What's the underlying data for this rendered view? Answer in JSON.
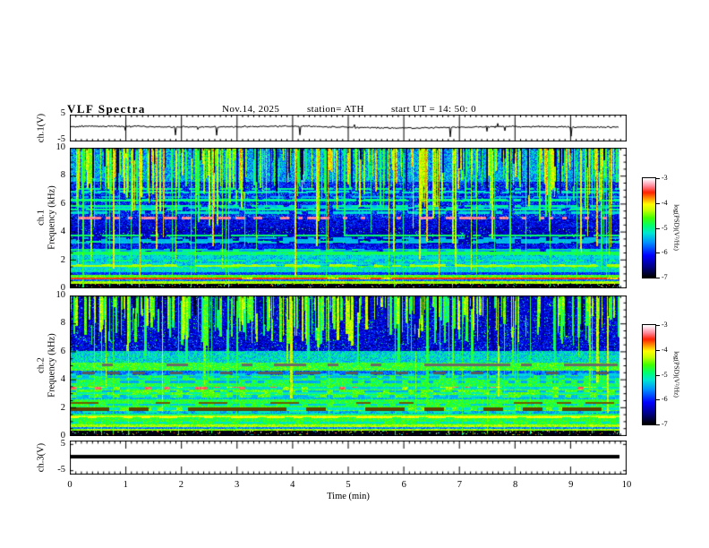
{
  "title": {
    "main": "VLF Spectra",
    "date": "Nov.14, 2025",
    "station": "station= ATH",
    "start_ut": "start UT =  14: 50: 0"
  },
  "time_axis": {
    "label": "Time (min)",
    "min": 0,
    "max": 10,
    "data_end": 9.87,
    "minor_step": 0.1,
    "ticks": [
      "0",
      "1",
      "2",
      "3",
      "4",
      "5",
      "6",
      "7",
      "8",
      "9",
      "10"
    ]
  },
  "colorbar": {
    "label": "log(PSD)(V²/Hz)",
    "zlim": [
      -7,
      -3
    ],
    "ticks": [
      "-3",
      "-4",
      "-5",
      "-6",
      "-7"
    ],
    "gradient_stops": [
      [
        0.0,
        "#000000"
      ],
      [
        0.1,
        "#000080"
      ],
      [
        0.22,
        "#0000ff"
      ],
      [
        0.35,
        "#0090ff"
      ],
      [
        0.45,
        "#00e8d0"
      ],
      [
        0.52,
        "#00ff70"
      ],
      [
        0.6,
        "#40ff00"
      ],
      [
        0.68,
        "#c8ff00"
      ],
      [
        0.74,
        "#ffff00"
      ],
      [
        0.8,
        "#ff9000"
      ],
      [
        0.86,
        "#ff2000"
      ],
      [
        0.92,
        "#ff8090"
      ],
      [
        0.97,
        "#ffd0dc"
      ],
      [
        1.0,
        "#ffffff"
      ]
    ]
  },
  "chart_data": [
    {
      "type": "line",
      "name": "ch1-waveform",
      "ylabel": "ch.1(V)",
      "ylim": [
        -5,
        5
      ],
      "ytick_labels": [
        "5",
        "-5"
      ],
      "color": "#000000",
      "seed": 42,
      "baseline": 0.25,
      "noise": 0.4,
      "neg_spike_p": 0.02,
      "pos_spike_p": 0.008,
      "grid_minutes": true
    },
    {
      "type": "heatmap",
      "name": "ch1-spectrogram",
      "ylabel_lines": [
        "ch.1",
        "Frequency (kHz)"
      ],
      "xlim": [
        0,
        10
      ],
      "ylim": [
        0,
        10
      ],
      "zlim": [
        -7,
        -3
      ],
      "ytick_labels": [
        "10",
        "8",
        "6",
        "4",
        "2",
        "0"
      ],
      "seed": 7,
      "bands": [
        {
          "r": [
            0,
            0.3
          ],
          "v": -6.95,
          "n": 0.1,
          "sp": [
            0.08,
            -5.8,
            -3.0
          ]
        },
        {
          "r": [
            0.3,
            0.45
          ],
          "v": -4.35,
          "n": 0.25
        },
        {
          "r": [
            0.45,
            0.6
          ],
          "v": -5.7,
          "n": 0.3
        },
        {
          "r": [
            0.6,
            0.72
          ],
          "v": -3.9,
          "n": 0.25
        },
        {
          "r": [
            0.72,
            0.9
          ],
          "v": -4.6,
          "n": 0.3
        },
        {
          "r": [
            0.9,
            1.1
          ],
          "v": -5.9,
          "n": 0.3
        },
        {
          "r": [
            1.1,
            1.45
          ],
          "v": -5.15,
          "n": 0.35
        },
        {
          "r": [
            1.45,
            1.6
          ],
          "v": -4.7,
          "n": 0.3
        },
        {
          "r": [
            1.6,
            2.35
          ],
          "v": -5.35,
          "n": 0.4
        },
        {
          "r": [
            2.35,
            2.6
          ],
          "v": -4.95,
          "n": 0.3
        },
        {
          "r": [
            2.6,
            3.1
          ],
          "v": -6.1,
          "n": 0.4
        },
        {
          "r": [
            3.1,
            4.3
          ],
          "v": -6.35,
          "n": 0.4,
          "sp": [
            0.05,
            -5.3,
            -4.6
          ]
        },
        {
          "r": [
            4.3,
            4.95
          ],
          "v": -6.2,
          "n": 0.45
        },
        {
          "r": [
            4.95,
            7.6
          ],
          "v": -6.05,
          "n": 0.5,
          "sp": [
            0.04,
            -5.3,
            -4.5
          ]
        },
        {
          "r": [
            7.6,
            10.01
          ],
          "v": -5.5,
          "n": 0.5
        }
      ],
      "hlines": [
        {
          "f": 5.02,
          "w": 0.07,
          "val": -3.3,
          "dash": 0.5,
          "seg": 5
        },
        {
          "f": 5.6,
          "w": 0.05,
          "val": -5.0,
          "dash": 0.8,
          "seg": 9
        },
        {
          "f": 3.75,
          "w": 0.05,
          "val": -4.9,
          "dash": 0.85,
          "seg": 9
        },
        {
          "f": 3.3,
          "w": 0.05,
          "val": -5.0,
          "dash": 0.8,
          "seg": 9
        },
        {
          "f": 2.5,
          "w": 0.05,
          "val": -4.8,
          "dash": 0.75,
          "seg": 9
        },
        {
          "f": 1.62,
          "w": 0.06,
          "val": -4.35,
          "dash": 0.85,
          "seg": 10
        },
        {
          "f": 6.3,
          "w": 0.05,
          "val": -5.05,
          "dash": 0.7,
          "seg": 8
        },
        {
          "f": 6.9,
          "w": 0.05,
          "val": -5.2,
          "dash": 0.6,
          "seg": 8
        },
        {
          "f": 0.66,
          "w": 0.04,
          "val": -3.6,
          "dash": 0.9,
          "seg": 12
        }
      ],
      "random_hlines": {
        "count": 18,
        "fMin": 1.2,
        "fMax": 7.5,
        "vMin": -5.5,
        "vMax": -4.9,
        "dash": 0.6
      },
      "streaks": [
        {
          "count": 330,
          "wMin": 1,
          "wMax": 2,
          "dMin": 5.5,
          "dMax": 9.4,
          "longP": 0.18,
          "longDMin": 0.8,
          "vMin": -5.0,
          "vMax": -3.9,
          "mode": "max"
        },
        {
          "count": 60,
          "wMin": 1,
          "wMax": 2,
          "dMin": 6.5,
          "dMax": 9.5,
          "vMin": -6.9,
          "vMax": -6.3,
          "mode": "set"
        },
        {
          "count": 18,
          "wMin": 1,
          "wMax": 1,
          "dMin": 0,
          "dMax": 0.3,
          "vMin": -5.0,
          "vMax": -4.7,
          "mode": "max"
        }
      ]
    },
    {
      "type": "heatmap",
      "name": "ch2-spectrogram",
      "ylabel_lines": [
        "ch.2",
        "Frequency (kHz)"
      ],
      "xlim": [
        0,
        10
      ],
      "ylim": [
        0,
        10
      ],
      "zlim": [
        -7,
        -3
      ],
      "ytick_labels": [
        "10",
        "8",
        "6",
        "4",
        "2",
        "0"
      ],
      "seed": 19,
      "bands": [
        {
          "r": [
            0,
            0.35
          ],
          "v": -6.95,
          "n": 0.1,
          "sp": [
            0.08,
            -5.5,
            -3.0
          ]
        },
        {
          "r": [
            0.35,
            0.5
          ],
          "v": -4.4,
          "n": 0.25
        },
        {
          "r": [
            0.5,
            0.62
          ],
          "v": -5.6,
          "n": 0.3
        },
        {
          "r": [
            0.62,
            0.78
          ],
          "v": -4.35,
          "n": 0.25
        },
        {
          "r": [
            0.78,
            1.3
          ],
          "v": -4.75,
          "n": 0.3
        },
        {
          "r": [
            1.3,
            1.42
          ],
          "v": -4.2,
          "n": 0.25
        },
        {
          "r": [
            1.42,
            1.6
          ],
          "v": -4.9,
          "n": 0.3
        },
        {
          "r": [
            1.6,
            1.78
          ],
          "v": -5.5,
          "n": 0.3
        },
        {
          "r": [
            1.78,
            2.05
          ],
          "v": -4.55,
          "n": 0.3
        },
        {
          "r": [
            2.05,
            2.6
          ],
          "v": -4.75,
          "n": 0.3
        },
        {
          "r": [
            2.6,
            2.72
          ],
          "v": -5.4,
          "n": 0.25
        },
        {
          "r": [
            2.72,
            3.28
          ],
          "v": -4.6,
          "n": 0.3
        },
        {
          "r": [
            3.28,
            3.52
          ],
          "v": -4.35,
          "n": 0.3
        },
        {
          "r": [
            3.52,
            4.35
          ],
          "v": -4.8,
          "n": 0.35
        },
        {
          "r": [
            4.35,
            4.65
          ],
          "v": -5.7,
          "n": 0.35
        },
        {
          "r": [
            4.65,
            5.25
          ],
          "v": -4.7,
          "n": 0.35
        },
        {
          "r": [
            5.25,
            6.05
          ],
          "v": -5.25,
          "n": 0.45
        },
        {
          "r": [
            6.05,
            10.01
          ],
          "v": -6.25,
          "n": 0.45,
          "sp": [
            0.05,
            -5.3,
            -4.6
          ]
        }
      ],
      "hlines": [
        {
          "f": 3.4,
          "w": 0.09,
          "val": -3.4,
          "dash": 0.55,
          "seg": 7
        },
        {
          "f": 1.9,
          "w": 0.08,
          "color": "#5a4200",
          "dash": 0.45,
          "seg": 22
        },
        {
          "f": 1.32,
          "w": 0.05,
          "val": -4.05,
          "dash": 0.7,
          "seg": 10
        },
        {
          "f": 0.95,
          "w": 0.04,
          "val": -5.2,
          "dash": 0.6,
          "seg": 9
        },
        {
          "f": 2.35,
          "w": 0.04,
          "color": "#6e5a00",
          "dash": 0.4,
          "seg": 16
        },
        {
          "f": 5.05,
          "w": 0.05,
          "color": "#6a6a6a",
          "dash": 0.5,
          "seg": 12
        },
        {
          "f": 4.5,
          "w": 0.05,
          "color": "#585858",
          "dash": 0.45,
          "seg": 14
        }
      ],
      "random_hlines": {
        "count": 14,
        "fMin": 0.8,
        "fMax": 5.2,
        "vMin": -5.5,
        "vMax": -5.0,
        "dash": 0.5
      },
      "streaks": [
        {
          "count": 310,
          "wMin": 1,
          "wMax": 3,
          "dMin": 6.5,
          "dMax": 9.4,
          "longP": 0.15,
          "longDMin": 1.2,
          "vMin": -5.1,
          "vMax": -4.2,
          "mode": "max"
        },
        {
          "count": 90,
          "wMin": 1,
          "wMax": 2,
          "dMin": 6.0,
          "dMax": 9.2,
          "vMin": -6.9,
          "vMax": -6.2,
          "mode": "set"
        },
        {
          "count": 16,
          "wMin": 1,
          "wMax": 1,
          "dMin": 0,
          "dMax": 0.3,
          "vMin": -4.9,
          "vMax": -4.6,
          "mode": "max"
        }
      ]
    },
    {
      "type": "line",
      "name": "ch3-waveform",
      "ylabel": "ch.3(V)",
      "ylim": [
        -6.3,
        6.3
      ],
      "ytick_vals": [
        5,
        -5
      ],
      "ytick_labels": [
        "5",
        "-5"
      ],
      "constant": 0.3,
      "thickness": 4,
      "color": "#000000",
      "seed": 3
    }
  ]
}
